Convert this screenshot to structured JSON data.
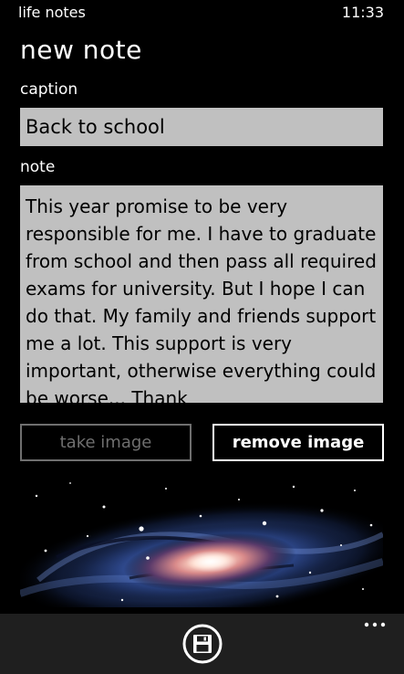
{
  "status_bar": {
    "app_name": "life notes",
    "time": "11:33"
  },
  "page": {
    "title": "new note"
  },
  "caption": {
    "label": "caption",
    "value": "Back to school"
  },
  "note": {
    "label": "note",
    "value": "This year promise to be very responsible for me. I have to graduate from school and then pass all required exams for university. But I hope I can do that. My family and friends support me a lot. This support is very important, otherwise everything could be worse... Thank"
  },
  "buttons": {
    "take_image": "take image",
    "remove_image": "remove image"
  },
  "attached_image": {
    "subject": "galaxy"
  },
  "app_bar": {
    "save_icon": "save-icon",
    "more_icon": "ellipsis-icon"
  },
  "colors": {
    "background": "#000000",
    "input_background": "#c0c0c0",
    "disabled_button": "#6f6f6f",
    "app_bar": "#1f1f1f"
  }
}
